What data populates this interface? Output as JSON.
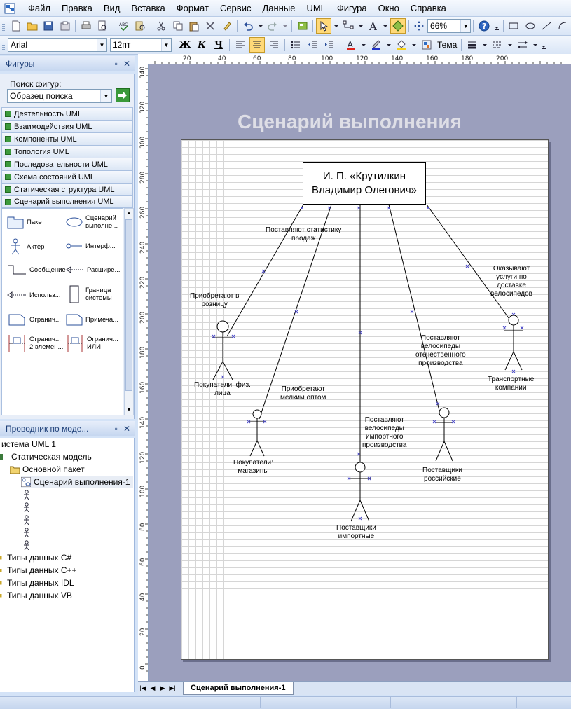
{
  "menu": [
    "Файл",
    "Правка",
    "Вид",
    "Вставка",
    "Формат",
    "Сервис",
    "Данные",
    "UML",
    "Фигура",
    "Окно",
    "Справка"
  ],
  "toolbar": {
    "zoom": "66%",
    "font": "Arial",
    "font_size": "12пт",
    "bold": "Ж",
    "italic": "К",
    "underline": "Ч",
    "theme": "Тема"
  },
  "shapes_panel": {
    "title": "Фигуры",
    "search_label": "Поиск фигур:",
    "search_value": "Образец поиска",
    "stencils": [
      "Деятельность UML",
      "Взаимодействия UML",
      "Компоненты UML",
      "Топология UML",
      "Последовательности UML",
      "Схема состояний UML",
      "Статическая структура UML",
      "Сценарий выполнения UML"
    ],
    "shapes": [
      {
        "label": "Пакет",
        "icon": "package-icon"
      },
      {
        "label": "Сценарий выполне...",
        "icon": "usecase-icon"
      },
      {
        "label": "Актер",
        "icon": "actor-icon"
      },
      {
        "label": "Интерф...",
        "icon": "interface-icon"
      },
      {
        "label": "Сообщение",
        "icon": "message-icon"
      },
      {
        "label": "Расшире...",
        "icon": "extend-icon"
      },
      {
        "label": "Использ...",
        "icon": "uses-icon"
      },
      {
        "label": "Граница системы",
        "icon": "system-boundary-icon"
      },
      {
        "label": "Огранич...",
        "icon": "constraint-icon"
      },
      {
        "label": "Примеча...",
        "icon": "note-icon"
      },
      {
        "label": "Огранич... 2 элемен...",
        "icon": "constraint-2-icon"
      },
      {
        "label": "Огранич... ИЛИ",
        "icon": "constraint-or-icon"
      }
    ]
  },
  "explorer": {
    "title": "Проводник по моде...",
    "items": [
      {
        "label": "истема UML 1",
        "level": 0
      },
      {
        "label": "Статическая модель",
        "level": 0
      },
      {
        "label": "Основной пакет",
        "level": 1
      },
      {
        "label": "Сценарий выполнения-1",
        "level": 2
      },
      {
        "label": "",
        "level": 2
      },
      {
        "label": "",
        "level": 2
      },
      {
        "label": "",
        "level": 2
      },
      {
        "label": "",
        "level": 2
      },
      {
        "label": "",
        "level": 2
      },
      {
        "label": "Типы данных C#",
        "level": 0
      },
      {
        "label": "Типы данных C++",
        "level": 0
      },
      {
        "label": "Типы данных IDL",
        "level": 0
      },
      {
        "label": "Типы данных VB",
        "level": 0
      }
    ]
  },
  "rulers": {
    "horizontal": [
      "20",
      "40",
      "60",
      "80",
      "100",
      "120",
      "140",
      "160",
      "180",
      "200"
    ],
    "vertical": [
      "340",
      "320",
      "300",
      "280",
      "260",
      "240",
      "220",
      "200",
      "180",
      "160",
      "140",
      "120",
      "100",
      "80",
      "60",
      "40",
      "20",
      "0"
    ]
  },
  "diagram": {
    "title": "Сценарий выполнения",
    "center": "И. П. «Крутилкин\nВладимир Олегович»",
    "actors": [
      "Покупатели: физ.\nлица",
      "Покупатели:\nмагазины",
      "Поставщики\nимпортные",
      "Поставщики\nроссийские",
      "Транспортные\nкомпании"
    ],
    "connections": [
      "Приобретают в\nрозницу",
      "Поставляют статистику\nпродаж",
      "Приобретают\nмелким оптом",
      "Поставляют\nвелосипеды\nимпортного\nпроизводства",
      "Поставляют\nвелосипеды\nотечественного\nпроизводства",
      "Оказывают\nуслуги по\nдоставке\nвелосипедов"
    ]
  },
  "page_tab": "Сценарий выполнения-1"
}
